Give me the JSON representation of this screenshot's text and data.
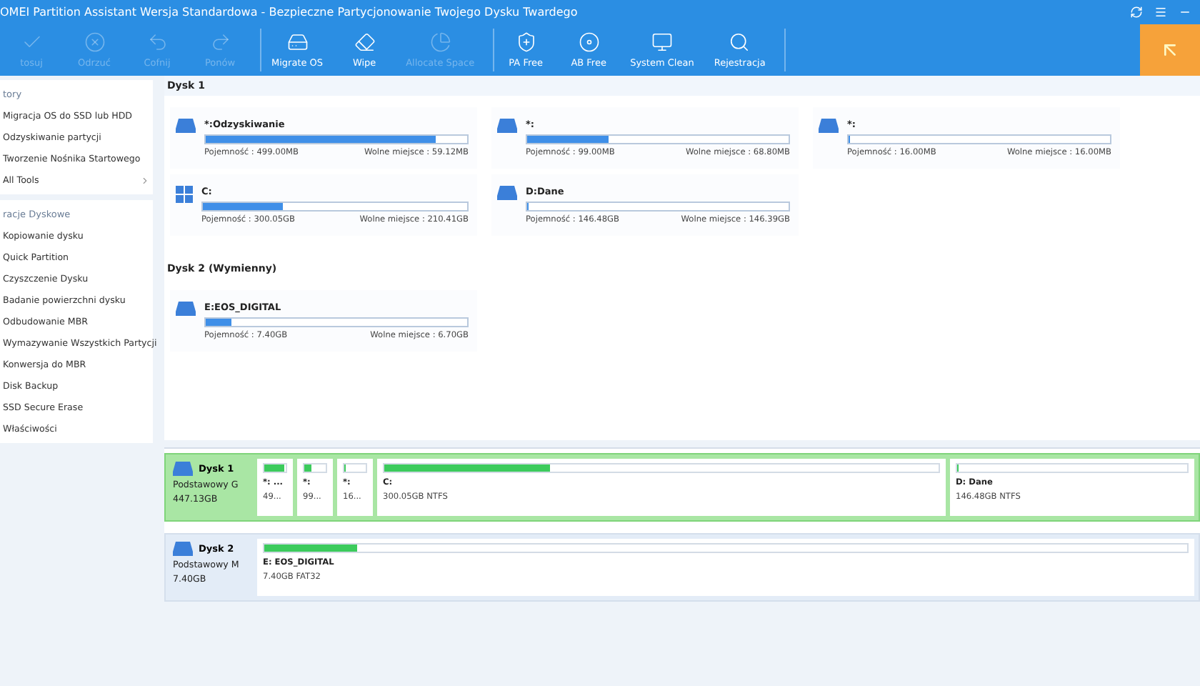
{
  "window": {
    "title": "OMEI Partition Assistant Wersja Standardowa - Bezpieczne Partycjonowanie Twojego Dysku Twardego"
  },
  "toolbar": {
    "groups": [
      {
        "items": [
          {
            "kind": "apply",
            "label": "tosuj",
            "disabled": true
          },
          {
            "kind": "discard",
            "label": "Odrzuć",
            "disabled": true
          },
          {
            "kind": "undo",
            "label": "Cofnij",
            "disabled": true
          },
          {
            "kind": "redo",
            "label": "Ponów",
            "disabled": true
          }
        ]
      },
      {
        "items": [
          {
            "kind": "migrate",
            "label": "Migrate OS",
            "disabled": false
          },
          {
            "kind": "wipe",
            "label": "Wipe",
            "disabled": false
          },
          {
            "kind": "allocate",
            "label": "Allocate Space",
            "disabled": true
          }
        ]
      },
      {
        "items": [
          {
            "kind": "pa",
            "label": "PA Free",
            "disabled": false
          },
          {
            "kind": "ab",
            "label": "AB Free",
            "disabled": false
          },
          {
            "kind": "clean",
            "label": "System Clean",
            "disabled": false
          },
          {
            "kind": "register",
            "label": "Rejestracja",
            "disabled": false
          }
        ]
      }
    ]
  },
  "sidebar": {
    "sections": [
      {
        "title": "tory",
        "items": [
          {
            "label": "Migracja OS do SSD lub HDD"
          },
          {
            "label": "Odzyskiwanie partycji"
          },
          {
            "label": "Tworzenie Nośnika Startowego"
          },
          {
            "label": "All Tools",
            "expandable": true
          }
        ]
      },
      {
        "title": "racje Dyskowe",
        "items": [
          {
            "label": "Kopiowanie dysku"
          },
          {
            "label": "Quick Partition"
          },
          {
            "label": "Czyszczenie Dysku"
          },
          {
            "label": "Badanie powierzchni dysku"
          },
          {
            "label": "Odbudowanie MBR"
          },
          {
            "label": "Wymazywanie Wszystkich Partycji"
          },
          {
            "label": "Konwersja do MBR"
          },
          {
            "label": "Disk Backup"
          },
          {
            "label": "SSD Secure Erase"
          },
          {
            "label": "Właściwości"
          }
        ]
      }
    ]
  },
  "disks": [
    {
      "title": "Dysk 1",
      "partitions": [
        {
          "kind": "drive",
          "name": "*:Odzyskiwanie",
          "level": 0.88,
          "capacity": "Pojemność : 499.00MB",
          "free": "Wolne miejsce : 59.12MB"
        },
        {
          "kind": "drive",
          "name": "*:",
          "level": 0.31,
          "capacity": "Pojemność : 99.00MB",
          "free": "Wolne miejsce : 68.80MB"
        },
        {
          "kind": "drive",
          "name": "*:",
          "level": 0,
          "capacity": "Pojemność : 16.00MB",
          "free": "Wolne miejsce : 16.00MB"
        },
        {
          "kind": "windows",
          "name": "C:",
          "level": 0.3,
          "capacity": "Pojemność : 300.05GB",
          "free": "Wolne miejsce : 210.41GB"
        },
        {
          "kind": "drive",
          "name": "D:Dane",
          "level": 0,
          "capacity": "Pojemność : 146.48GB",
          "free": "Wolne miejsce : 146.39GB"
        }
      ]
    },
    {
      "title": "Dysk 2 (Wymienny)",
      "partitions": [
        {
          "kind": "drive",
          "name": "E:EOS_DIGITAL",
          "level": 0.1,
          "capacity": "Pojemność : 7.40GB",
          "free": "Wolne miejsce : 6.70GB"
        }
      ]
    }
  ],
  "disk_map": [
    {
      "name": "Dysk 1",
      "type": "Podstawowy G",
      "size": "447.13GB",
      "selected": true,
      "partitions": [
        {
          "kind": "compact",
          "name": "*: ...",
          "info": "49...",
          "level": 0.9
        },
        {
          "kind": "compact",
          "name": "*:",
          "info": "99...",
          "level": 0.3
        },
        {
          "kind": "compact",
          "name": "*:",
          "info": "16...",
          "level": 0
        },
        {
          "kind": "wide",
          "name": "C:",
          "info": "300.05GB NTFS",
          "level": 0.3
        },
        {
          "kind": "edge",
          "name": "D: Dane",
          "info": "146.48GB NTFS",
          "level": 0
        }
      ]
    },
    {
      "name": "Dysk 2",
      "type": "Podstawowy M",
      "size": "7.40GB",
      "selected": false,
      "partitions": [
        {
          "kind": "full",
          "name": "E: EOS_DIGITAL",
          "info": "7.40GB FAT32",
          "level": 0.1
        }
      ]
    }
  ]
}
